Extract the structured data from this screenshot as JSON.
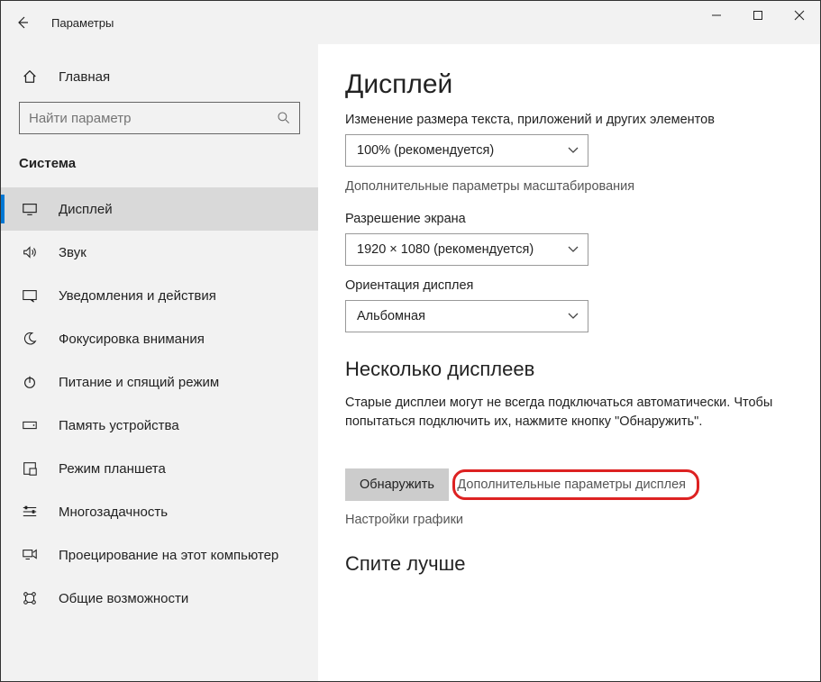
{
  "titlebar": {
    "title": "Параметры"
  },
  "sidebar": {
    "home_label": "Главная",
    "search_placeholder": "Найти параметр",
    "section_label": "Система",
    "items": [
      {
        "label": "Дисплей",
        "active": true
      },
      {
        "label": "Звук"
      },
      {
        "label": "Уведомления и действия"
      },
      {
        "label": "Фокусировка внимания"
      },
      {
        "label": "Питание и спящий режим"
      },
      {
        "label": "Память устройства"
      },
      {
        "label": "Режим планшета"
      },
      {
        "label": "Многозадачность"
      },
      {
        "label": "Проецирование на этот компьютер"
      },
      {
        "label": "Общие возможности"
      }
    ]
  },
  "main": {
    "heading": "Дисплей",
    "scale_caption": "Изменение размера текста, приложений и других элементов",
    "scale_value": "100% (рекомендуется)",
    "advanced_scaling_link": "Дополнительные параметры масштабирования",
    "resolution_label": "Разрешение экрана",
    "resolution_value": "1920 × 1080 (рекомендуется)",
    "orientation_label": "Ориентация дисплея",
    "orientation_value": "Альбомная",
    "multi_heading": "Несколько дисплеев",
    "multi_desc": "Старые дисплеи могут не всегда подключаться автоматически. Чтобы попытаться подключить их, нажмите кнопку \"Обнаружить\".",
    "detect_button": "Обнаружить",
    "advanced_display_link": "Дополнительные параметры дисплея",
    "graphics_link": "Настройки графики",
    "sleep_heading": "Спите лучше"
  }
}
